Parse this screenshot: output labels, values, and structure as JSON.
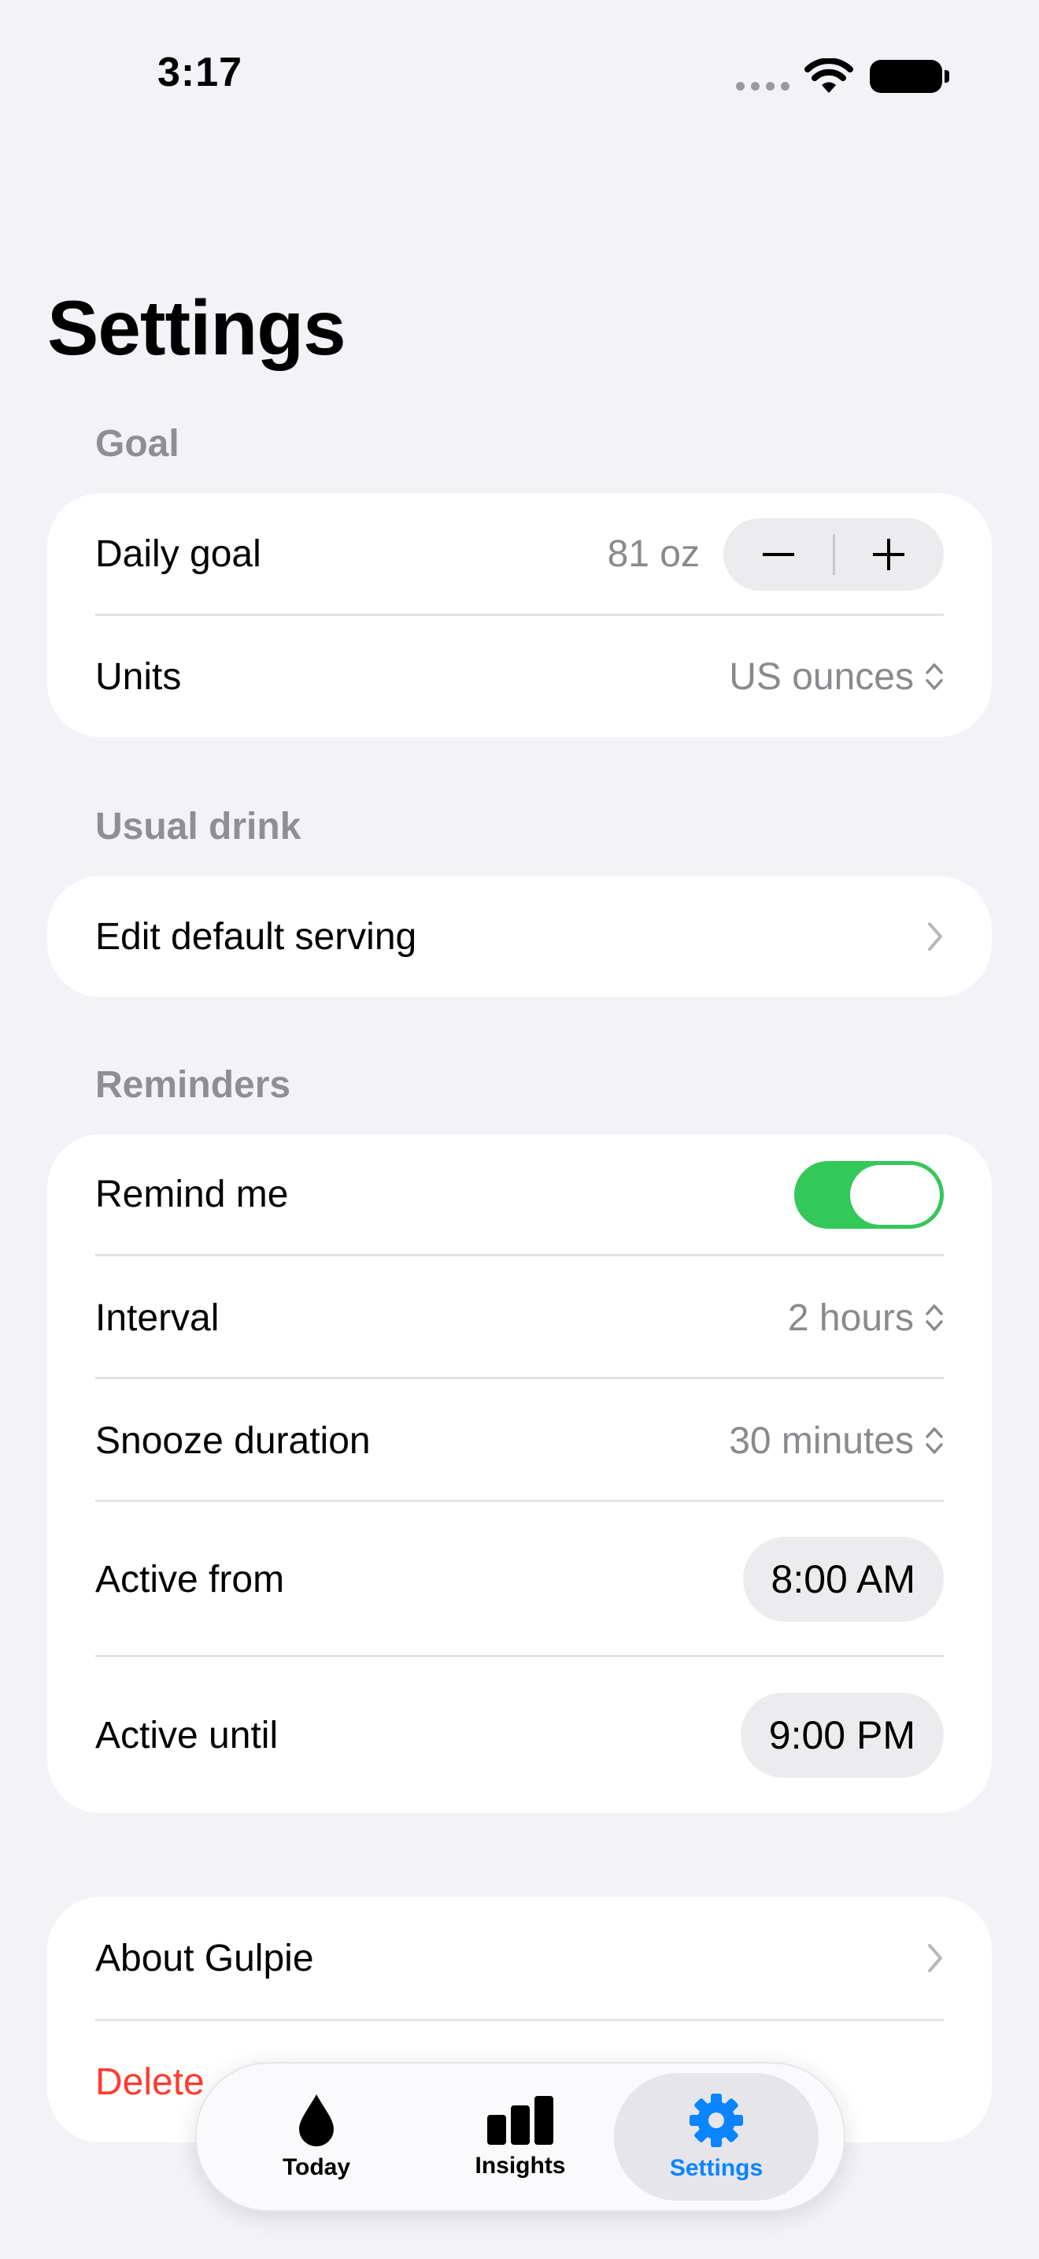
{
  "status_bar": {
    "time": "3:17"
  },
  "page": {
    "title": "Settings"
  },
  "goal_section": {
    "header": "Goal",
    "daily_goal_label": "Daily goal",
    "daily_goal_value": "81 oz",
    "decrement_symbol": "−",
    "increment_symbol": "+",
    "units_label": "Units",
    "units_value": "US ounces"
  },
  "usual_drink_section": {
    "header": "Usual drink",
    "edit_serving_label": "Edit default serving"
  },
  "reminders_section": {
    "header": "Reminders",
    "remind_me_label": "Remind me",
    "remind_me_on": true,
    "interval_label": "Interval",
    "interval_value": "2 hours",
    "snooze_label": "Snooze duration",
    "snooze_value": "30 minutes",
    "active_from_label": "Active from",
    "active_from_value": "8:00 AM",
    "active_until_label": "Active until",
    "active_until_value": "9:00 PM"
  },
  "about_section": {
    "about_label": "About Gulpie",
    "delete_label": "Delete"
  },
  "tab_bar": {
    "tabs": [
      {
        "label": "Today",
        "icon": "drop-icon",
        "active": false
      },
      {
        "label": "Insights",
        "icon": "bar-chart-icon",
        "active": false
      },
      {
        "label": "Settings",
        "icon": "gear-icon",
        "active": true
      }
    ]
  },
  "colors": {
    "background": "#f2f2f7",
    "toggle_on": "#34c759",
    "accent": "#0a84ff",
    "destructive": "#ff3b30",
    "secondary_text": "#8a8a8e"
  }
}
